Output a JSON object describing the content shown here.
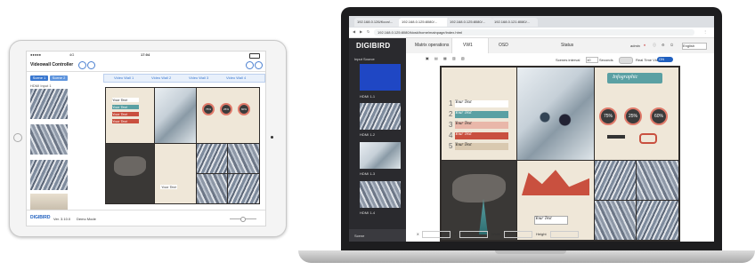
{
  "tablet": {
    "status_carrier": "●●●●●",
    "status_network": "4G",
    "status_time": "17:04",
    "app_title": "Videowall Controller",
    "scene_buttons": [
      "Scene 1",
      "Scene 2"
    ],
    "sidebar_label": "HDMI Input 1",
    "layout_tabs": [
      "Video Wall 1",
      "Video Wall 2",
      "Video Wall 3",
      "Video Wall 4"
    ],
    "logo": "DIGIBIRD",
    "version": "Ver. 3.10.0",
    "mode": "Demo Mode"
  },
  "browser": {
    "tabs": [
      "192.168.0.126/Kcon/...",
      "192.168.0.125:8080/...",
      "192.168.0.125:8080/...",
      "192.168.0.121:8080/..."
    ],
    "url": "192.168.0.125:8080/kiosk/home/mainpage/index.html"
  },
  "app": {
    "logo": "DIGIBIRD",
    "nav": [
      "Matrix operations",
      "VW1",
      "OSD",
      "Status"
    ],
    "active_nav": "VW1",
    "user": "admin",
    "language": "English",
    "sidebar_title": "Input Source",
    "sidebar_inputs": [
      "HDMI 1-1",
      "HDMI 1-2",
      "HDMI 1-3",
      "HDMI 1-4"
    ],
    "sidebar_footer": "Scene",
    "scene_interval_label": "Scenes interval",
    "scene_interval_value": "10",
    "seconds_label": "Seconds",
    "realtime_label": "Real Time Video",
    "realtime_state": "ON",
    "footer_fields": [
      "X",
      "Y",
      "Width",
      "Height"
    ]
  },
  "wall": {
    "infographic_title": "Infographic",
    "rows": [
      {
        "num": "1",
        "text": "Your Text"
      },
      {
        "num": "2",
        "text": "Your Text"
      },
      {
        "num": "3",
        "text": "Your Text"
      },
      {
        "num": "4",
        "text": "Your Text"
      },
      {
        "num": "5",
        "text": "Your Text"
      }
    ],
    "percentages": [
      "75%",
      "25%",
      "60%"
    ],
    "bottom_text": "Your Text"
  },
  "colors": {
    "accent_blue": "#1f5fbf",
    "app_dark": "#2a2a2e",
    "info_red": "#c9503f",
    "info_teal": "#5aa0a3"
  }
}
